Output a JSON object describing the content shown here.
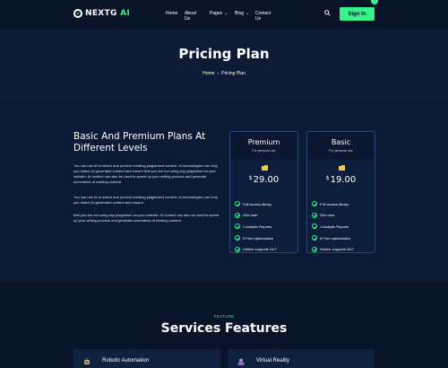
{
  "header": {
    "logo_main": "NEXTG",
    "logo_accent": "AI",
    "nav": [
      {
        "label": "Home"
      },
      {
        "label": "About Us"
      },
      {
        "label": "Pages"
      },
      {
        "label": "Blog"
      },
      {
        "label": "Contact Us"
      }
    ],
    "signin_label": "Sign In",
    "search_icon": "search-icon"
  },
  "hero": {
    "title": "Pricing Plan",
    "breadcrumb": [
      "Home",
      "Pricing Plan"
    ]
  },
  "pricing": {
    "headline": "Basic And Premium Plans At Different Levels",
    "paragraphs": [
      "You can use AI to detect and prevent creating plagiarized content. AI technologies can help you detect AI-generated content and ensure that you are not using any plagiarism on your website. AI content can also be used to speed up your writing process and generate summaries of existing content.",
      "You can use AI to detect and prevent creating plagiarized content. AI technologies can help you detect AI-generated content and ensure.",
      "that you are not using any plagiarism on your website. AI content can also be used to speed up your writing process and generate summaries of existing content."
    ],
    "plans": [
      {
        "name": "Premium",
        "subtitle": "For personal use",
        "currency": "$",
        "price": "29.00",
        "features": [
          "Full access library",
          "One user",
          "1 Analytic Reports",
          "5 Free optimization",
          "Hotline supports 24/7"
        ]
      },
      {
        "name": "Basic",
        "subtitle": "For personal use",
        "currency": "$",
        "price": "19.00",
        "features": [
          "Full access library",
          "One user",
          "1 Analytic Reports",
          "5 Free optimization",
          "Hotline supports 24/7"
        ]
      }
    ]
  },
  "services": {
    "tag": "FEATURE",
    "title": "Services Features",
    "cards": [
      {
        "name": "Robotic Automation",
        "icon": "robot-icon"
      },
      {
        "name": "Virtual Reality",
        "icon": "vr-headset-icon"
      }
    ]
  },
  "colors": {
    "accent": "#39f28a",
    "background": "#0b1730",
    "card_border": "#2d4672"
  }
}
